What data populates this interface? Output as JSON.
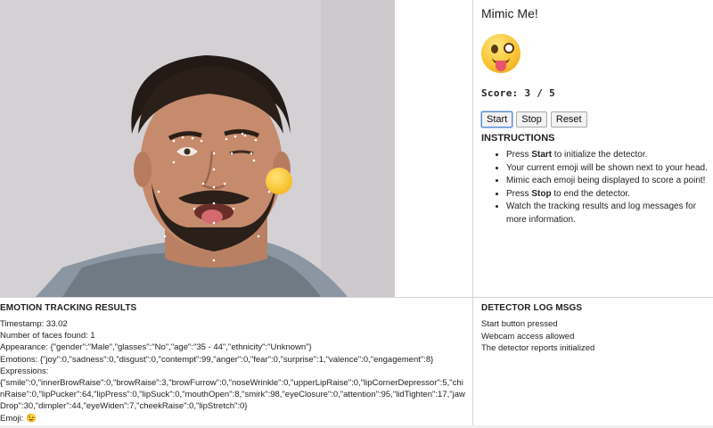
{
  "game": {
    "title": "Mimic Me!",
    "target_emoji": "stuck-out-tongue-winking-eye",
    "score_label": "Score: 3 / 5",
    "buttons": {
      "start": "Start",
      "stop": "Stop",
      "reset": "Reset"
    },
    "instructions_title": "INSTRUCTIONS",
    "instructions": [
      {
        "pre": "Press ",
        "bold": "Start",
        "post": " to initialize the detector."
      },
      {
        "pre": "Your current emoji will be shown next to your head.",
        "bold": "",
        "post": ""
      },
      {
        "pre": "Mimic each emoji being displayed to score a point!",
        "bold": "",
        "post": ""
      },
      {
        "pre": "Press ",
        "bold": "Stop",
        "post": " to end the detector."
      },
      {
        "pre": "Watch the tracking results and log messages for more information.",
        "bold": "",
        "post": ""
      }
    ]
  },
  "webcam": {
    "overlay_emoji": "😉"
  },
  "results": {
    "title": "EMOTION TRACKING RESULTS",
    "lines": [
      "Timestamp: 33.02",
      "Number of faces found: 1",
      "Appearance: {\"gender\":\"Male\",\"glasses\":\"No\",\"age\":\"35 - 44\",\"ethnicity\":\"Unknown\"}",
      "Emotions: {\"joy\":0,\"sadness\":0,\"disgust\":0,\"contempt\":99,\"anger\":0,\"fear\":0,\"surprise\":1,\"valence\":0,\"engagement\":8}",
      "Expressions:",
      "{\"smile\":0,\"innerBrowRaise\":0,\"browRaise\":3,\"browFurrow\":0,\"noseWrinkle\":0,\"upperLipRaise\":0,\"lipCornerDepressor\":5,\"chinRaise\":0,\"lipPucker\":64,\"lipPress\":0,\"lipSuck\":0,\"mouthOpen\":8,\"smirk\":98,\"eyeClosure\":0,\"attention\":95,\"lidTighten\":17,\"jawDrop\":30,\"dimpler\":44,\"eyeWiden\":7,\"cheekRaise\":0,\"lipStretch\":0}",
      "Emoji: 😉"
    ]
  },
  "log": {
    "title": "DETECTOR LOG MSGS",
    "lines": [
      "Start button pressed",
      "Webcam access allowed",
      "The detector reports initialized"
    ]
  }
}
